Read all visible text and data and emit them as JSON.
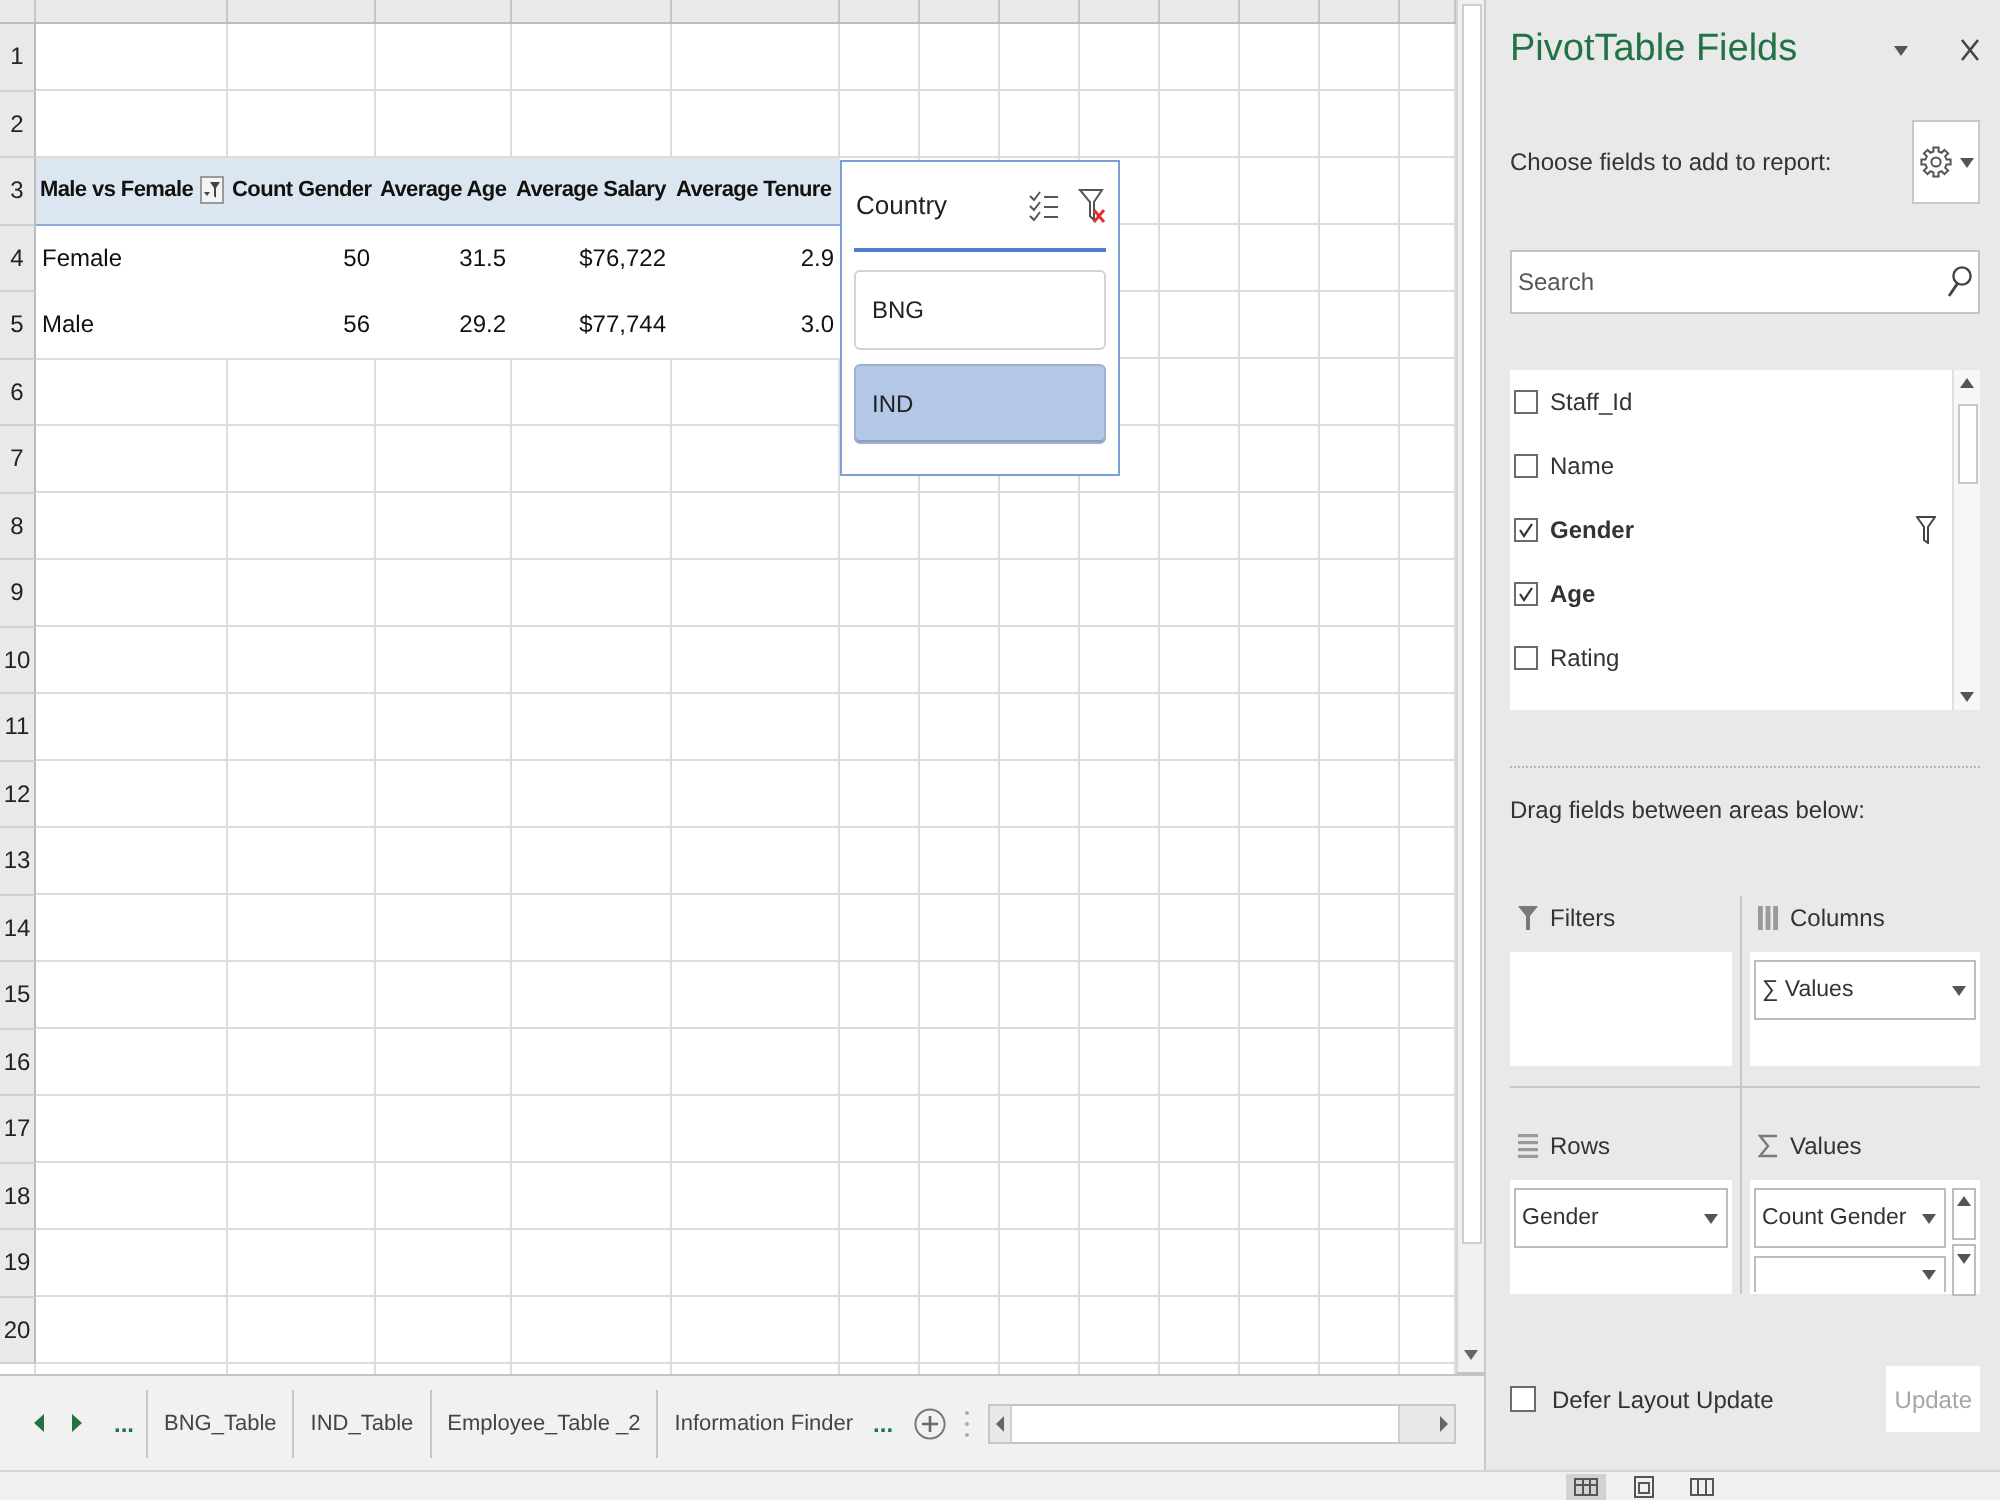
{
  "sheet": {
    "row_numbers": [
      "1",
      "2",
      "3",
      "4",
      "5",
      "6",
      "7",
      "8",
      "9",
      "10",
      "11",
      "12",
      "13",
      "14",
      "15",
      "16",
      "17",
      "18",
      "19",
      "20"
    ],
    "pivot_table": {
      "columns": [
        {
          "label": "Male vs Female",
          "filter_button": true
        },
        {
          "label": "Count Gender",
          "filter_button": false
        },
        {
          "label": "Average Age",
          "filter_button": false
        },
        {
          "label": "Average Salary",
          "filter_button": false
        },
        {
          "label": "Average Tenure",
          "filter_button": false
        }
      ],
      "rows": [
        {
          "cells": [
            "Female",
            "50",
            "31.5",
            "$76,722",
            "2.9"
          ]
        },
        {
          "cells": [
            "Male",
            "56",
            "29.2",
            "$77,744",
            "3.0"
          ]
        }
      ]
    },
    "slicer": {
      "title": "Country",
      "items": [
        {
          "label": "BNG",
          "selected": false
        },
        {
          "label": "IND",
          "selected": true
        }
      ]
    }
  },
  "sheet_tabs": {
    "more_left": "...",
    "tabs": [
      {
        "label": "BNG_Table",
        "selected": false
      },
      {
        "label": "IND_Table",
        "selected": false
      },
      {
        "label": "Employee_Table _2",
        "selected": false
      },
      {
        "label": "Information Finder",
        "selected": false
      }
    ],
    "more_right": "..."
  },
  "pivot_pane": {
    "title": "PivotTable Fields",
    "subtitle": "Choose fields to add to report:",
    "search": {
      "placeholder": "Search"
    },
    "fields": [
      {
        "label": "Staff_Id",
        "checked": false,
        "filtered": false
      },
      {
        "label": "Name",
        "checked": false,
        "filtered": false
      },
      {
        "label": "Gender",
        "checked": true,
        "filtered": true
      },
      {
        "label": "Age",
        "checked": true,
        "filtered": false
      },
      {
        "label": "Rating",
        "checked": false,
        "filtered": false
      }
    ],
    "areas_hint": "Drag fields between areas below:",
    "areas": [
      {
        "kind": "filters",
        "title": "Filters",
        "scrollable": false
      },
      {
        "kind": "columns",
        "title": "Columns",
        "scrollable": false,
        "items": [
          {
            "label": "∑ Values"
          }
        ]
      },
      {
        "kind": "rows",
        "title": "Rows",
        "scrollable": false,
        "items": [
          {
            "label": "Gender"
          }
        ]
      },
      {
        "kind": "values",
        "title": "Values",
        "scrollable": true,
        "items": [
          {
            "label": "Count Gender"
          }
        ]
      }
    ],
    "defer_update": {
      "label": "Defer Layout Update",
      "checked": false
    },
    "update_button": {
      "label": "Update",
      "disabled": true
    }
  },
  "status_bar": {
    "views": [
      {
        "kind": "normal",
        "selected": true
      },
      {
        "kind": "page_layout",
        "selected": false
      },
      {
        "kind": "page_break",
        "selected": false
      }
    ]
  }
}
